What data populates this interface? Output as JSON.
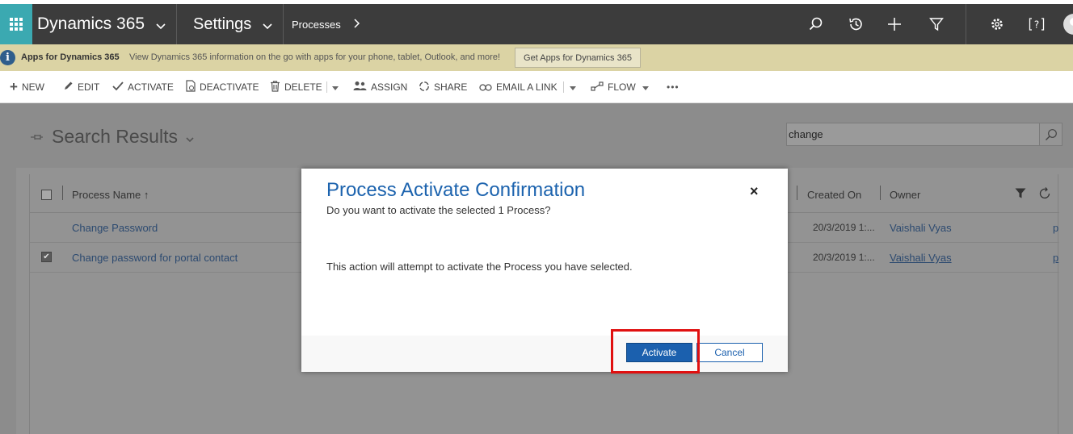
{
  "navbar": {
    "app_title": "Dynamics 365",
    "area_title": "Settings",
    "breadcrumb": "Processes",
    "icons": [
      "search-icon",
      "recent-icon",
      "plus-icon",
      "filter-icon",
      "gear-icon",
      "help-icon",
      "avatar"
    ]
  },
  "infobar": {
    "bold": "Apps for Dynamics 365",
    "text": "View Dynamics 365 information on the go with apps for your phone, tablet, Outlook, and more!",
    "button": "Get Apps for Dynamics 365"
  },
  "commands": {
    "new": "NEW",
    "edit": "EDIT",
    "activate": "ACTIVATE",
    "deactivate": "DEACTIVATE",
    "delete": "DELETE",
    "assign": "ASSIGN",
    "share": "SHARE",
    "email_link": "EMAIL A LINK",
    "flow": "FLOW",
    "more": "•••"
  },
  "view": {
    "title": "Search Results",
    "search_value": "change"
  },
  "grid": {
    "headers": {
      "process_name": "Process Name ↑",
      "created_on": "Created On",
      "owner": "Owner"
    },
    "rows": [
      {
        "name": "Change Password",
        "created_on": "20/3/2019 1:...",
        "owner": "Vaishali Vyas",
        "extra": "p",
        "checked": false
      },
      {
        "name": "Change password for portal contact",
        "created_on": "20/3/2019 1:...",
        "owner": "Vaishali Vyas",
        "extra": "p",
        "checked": true
      }
    ]
  },
  "dialog": {
    "title": "Process Activate Confirmation",
    "subtitle": "Do you want to activate the selected 1 Process?",
    "message": "This action will attempt to activate the Process you have selected.",
    "activate_label": "Activate",
    "cancel_label": "Cancel",
    "close_glyph": "×"
  },
  "colors": {
    "navbar": "#3c3c3c",
    "waffle": "#3ba9b1",
    "infobar": "#dbd3a4",
    "primary_button": "#1b60ae",
    "highlight": "#e01010"
  }
}
